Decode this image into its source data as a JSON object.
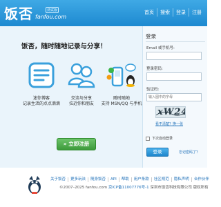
{
  "header": {
    "logo_text": "饭否",
    "logo_domain": "fanfou.com",
    "logo_badge": "测试版",
    "nav": [
      "首页",
      "搜索",
      "登录",
      "注册"
    ]
  },
  "intro": {
    "slogan": "饭否，随时随地记录与分享！",
    "features": [
      {
        "line1": "迷你博客",
        "line2": "记录生活的点点滴滴",
        "icon": "mini-blog-icon"
      },
      {
        "line1": "交流与分享",
        "line2": "拉近你和朋友",
        "icon": "friends-icon"
      },
      {
        "line1": "随时随地",
        "line2": "支持 MSN/QQ 与手机",
        "icon": "mobile-im-icon"
      }
    ],
    "signup_label": "» 立即注册"
  },
  "login": {
    "title": "登录",
    "email_label": "Email 或手机号:",
    "password_label": "登录密码:",
    "captcha_label": "验证码:",
    "captcha_placeholder": "输入图中的字母",
    "captcha_text": "xW24",
    "refresh_link": "看不清楚？换一张",
    "remember_label": "下次自动登录",
    "submit_label": "登录",
    "forgot_link": "忘记密码了？"
  },
  "footer": {
    "links": [
      "关于饭否",
      "更多玩法",
      "随身饭否",
      "API",
      "帮助",
      "用户条款",
      "社区规范",
      "隐私声明",
      "合作伙伴"
    ],
    "copyright": "©2007–2025 fanfou.com",
    "icp": "京ICP备11007776号-1",
    "company": "深圳市饭否科技有限公司 版权所有"
  },
  "colors": {
    "header": "#1d89d0",
    "panel": "#eaf4fb",
    "signup": "#3c9a3a",
    "link": "#1d6fb8"
  }
}
